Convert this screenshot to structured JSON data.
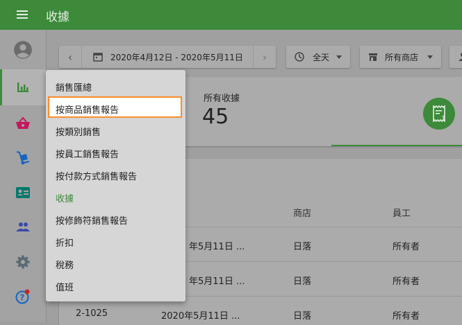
{
  "app": {
    "title": "收據"
  },
  "toolbar": {
    "date_range": "2020年4月12日 - 2020年5月11日",
    "day_filter": "全天",
    "store_filter": "所有商店"
  },
  "summary": {
    "receipts_label": "所有收據",
    "receipts_count": "45"
  },
  "menu": {
    "items": [
      {
        "label": "銷售匯總"
      },
      {
        "label": "按商品銷售報告",
        "selected": true
      },
      {
        "label": "按類別銷售"
      },
      {
        "label": "按員工銷售報告"
      },
      {
        "label": "按付款方式銷售報告"
      },
      {
        "label": "收據",
        "active": true
      },
      {
        "label": "按修飾符銷售報告"
      },
      {
        "label": "折扣"
      },
      {
        "label": "稅務"
      },
      {
        "label": "值班"
      }
    ]
  },
  "table": {
    "headers": {
      "store": "商店",
      "employee": "員工"
    },
    "rows": [
      {
        "receipt": "",
        "date": "年5月11日 ...",
        "store": "日落",
        "employee": "所有者"
      },
      {
        "receipt": "",
        "date": "年5月11日 ...",
        "store": "日落",
        "employee": "所有者"
      },
      {
        "receipt": "2-1025",
        "date": "2020年5月11日 ...",
        "store": "日落",
        "employee": "所有者"
      }
    ]
  },
  "colors": {
    "brand": "#3c8a3a",
    "highlight": "#ff8c2b"
  }
}
